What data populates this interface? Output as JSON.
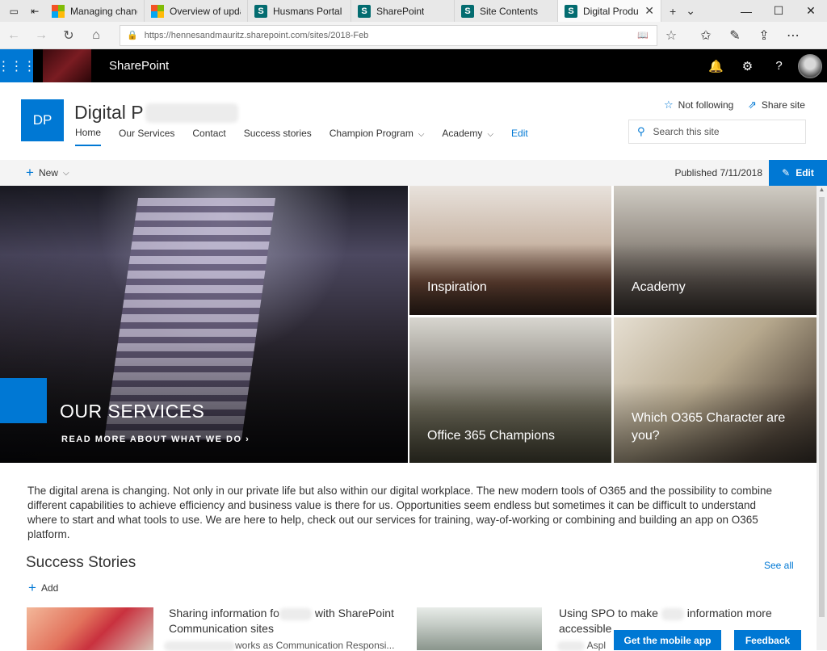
{
  "browser": {
    "tabs": [
      {
        "label": "Managing changes i",
        "favicon": "microsoft-icon",
        "active": false
      },
      {
        "label": "Overview of update",
        "favicon": "microsoft-icon",
        "active": false
      },
      {
        "label": "Husmans Portal - Hc",
        "favicon": "sharepoint-icon",
        "active": false
      },
      {
        "label": "SharePoint",
        "favicon": "sharepoint-icon",
        "active": false
      },
      {
        "label": "Site Contents",
        "favicon": "sharepoint-icon",
        "active": false
      },
      {
        "label": "Digital Productiv",
        "favicon": "sharepoint-icon",
        "active": true
      }
    ],
    "url": "https://hennesandmauritz.sharepoint.com/sites/2018-Feb"
  },
  "suite": {
    "title": "SharePoint"
  },
  "site": {
    "logo_initials": "DP",
    "title": "Digital P",
    "nav": [
      "Home",
      "Our Services",
      "Contact",
      "Success stories",
      "Champion Program",
      "Academy",
      "Edit"
    ],
    "follow_label": "Not following",
    "share_label": "Share site",
    "search_placeholder": "Search this site"
  },
  "command_bar": {
    "new_label": "New",
    "published": "Published 7/11/2018",
    "edit_label": "Edit"
  },
  "hero": {
    "main_title": "OUR SERVICES",
    "main_link": "READ MORE ABOUT WHAT WE DO",
    "tiles": [
      "Inspiration",
      "Academy",
      "Office 365 Champions",
      "Which O365 Character are you?"
    ]
  },
  "intro_text": "The digital arena is changing. Not only in our private life but also within our digital workplace. The new modern tools of O365 and the possibility to combine different capabilities to achieve efficiency and business value is there for us. Opportunities seem endless but sometimes it can be difficult to understand where to start and what tools to use. We are here to help, check out our services for training, way-of-working or combining and building an app on O365 platform.",
  "success": {
    "title": "Success Stories",
    "see_all": "See all",
    "add_label": "Add",
    "news": [
      {
        "title_a": "Sharing information fo",
        "title_b": "with SharePoint",
        "title_c": "Communication sites",
        "sub": "works as Communication Responsi..."
      },
      {
        "title_a": "Using SPO to make",
        "title_b": "information more",
        "title_c": "accessible",
        "sub": "Aspl"
      }
    ]
  },
  "floating": {
    "mobile_app": "Get the mobile app",
    "feedback": "Feedback"
  },
  "colors": {
    "accent": "#0078d4",
    "suite_bar": "#000000"
  }
}
